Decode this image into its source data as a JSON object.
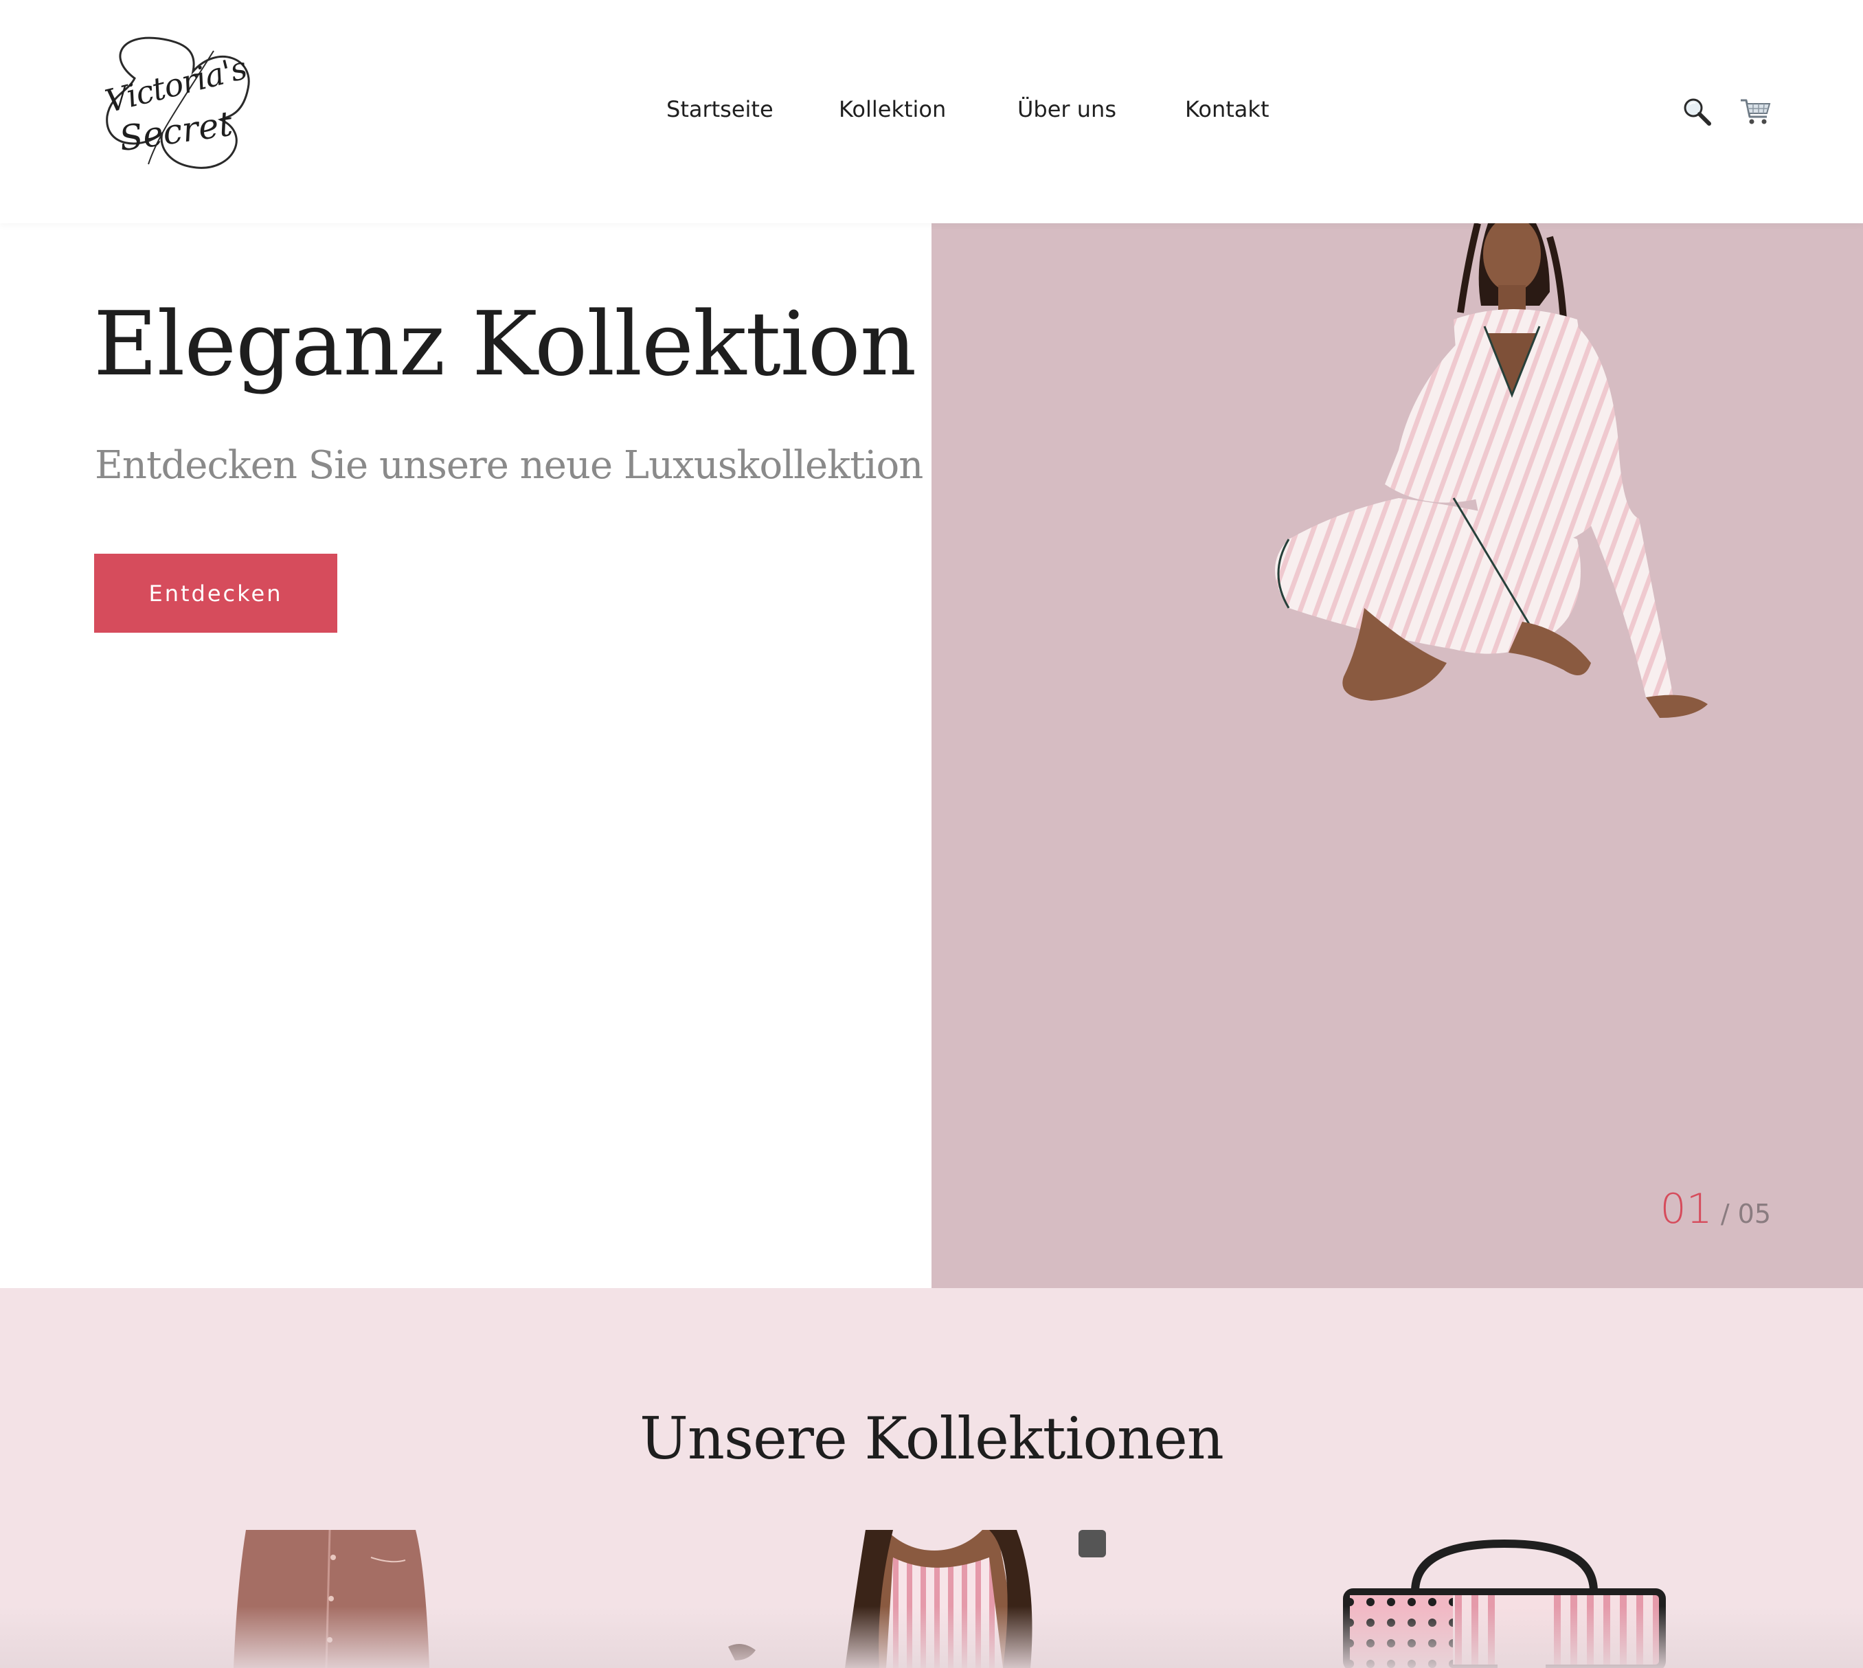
{
  "header": {
    "logo": {
      "line1": "Victoria's",
      "line2": "Secret"
    },
    "nav": [
      {
        "label": "Startseite"
      },
      {
        "label": "Kollektion"
      },
      {
        "label": "Über uns"
      },
      {
        "label": "Kontakt"
      }
    ],
    "icons": [
      "search-icon",
      "cart-icon"
    ]
  },
  "hero": {
    "title": "Eleganz Kollektion",
    "subtitle": "Entdecken Sie unsere neue Luxuskollektion",
    "cta_label": "Entdecken",
    "slide_current": "01",
    "slide_separator": "/",
    "slide_total": "05",
    "image": "model-in-striped-satin-pajamas"
  },
  "collections": {
    "title": "Unsere Kollektionen",
    "items": [
      {
        "image": "rose-pajama-set"
      },
      {
        "image": "striped-satin-cami-set"
      },
      {
        "image": "pink-striped-cosmetic-bag"
      }
    ]
  },
  "colors": {
    "accent": "#d64c5c",
    "hero_panel_bg": "#d6bcc2",
    "collections_bg": "#f3e2e6",
    "text_dark": "#1e1e1e",
    "text_muted": "#8a8a8a"
  }
}
